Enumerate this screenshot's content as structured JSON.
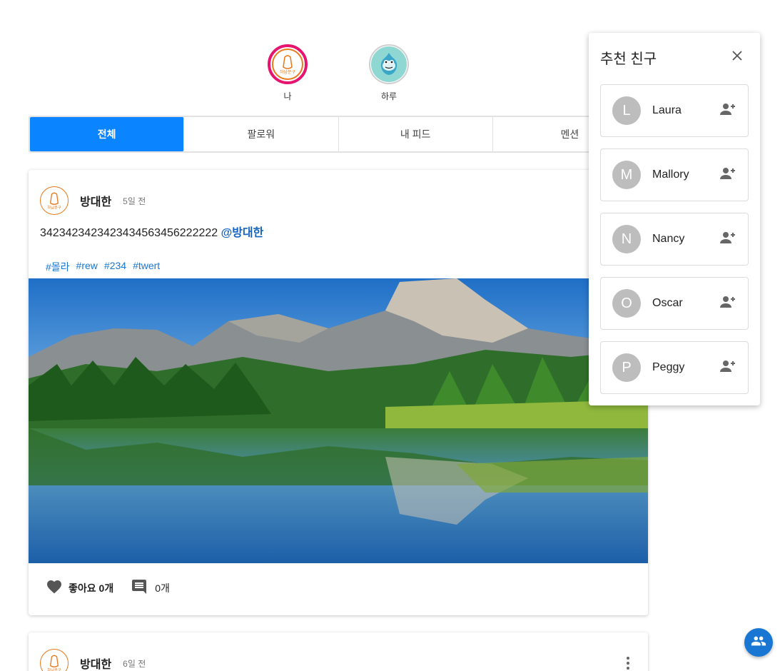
{
  "stories": [
    {
      "name": "나",
      "active": true
    },
    {
      "name": "하루",
      "active": false
    }
  ],
  "tabs": [
    {
      "label": "전체",
      "selected": true
    },
    {
      "label": "팔로워",
      "selected": false
    },
    {
      "label": "내 피드",
      "selected": false
    },
    {
      "label": "멘션",
      "selected": false
    }
  ],
  "posts": [
    {
      "author": "방대한",
      "time": "5일 전",
      "text": "3423423423423434563456222222",
      "mention": "@방대한",
      "tags": [
        "#몰라",
        "#rew",
        "#234",
        "#twert"
      ],
      "like_label": "좋아요 0개",
      "comment_count": "0개"
    },
    {
      "author": "방대한",
      "time": "6일 전"
    }
  ],
  "recommend": {
    "title": "추천 친구",
    "friends": [
      {
        "initial": "L",
        "name": "Laura"
      },
      {
        "initial": "M",
        "name": "Mallory"
      },
      {
        "initial": "N",
        "name": "Nancy"
      },
      {
        "initial": "O",
        "name": "Oscar"
      },
      {
        "initial": "P",
        "name": "Peggy"
      }
    ]
  },
  "colors": {
    "accent": "#0a84ff",
    "link": "#1976d2",
    "story_ring": "#e6136f",
    "fab": "#1976d2"
  },
  "icons": [
    "heart-icon",
    "comment-icon",
    "close-icon",
    "person-add-icon",
    "people-icon",
    "more-vert-icon"
  ]
}
